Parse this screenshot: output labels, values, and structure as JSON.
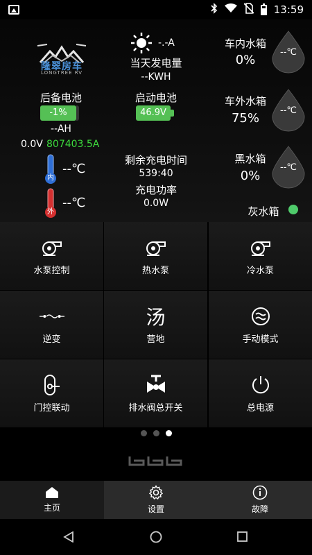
{
  "status_bar": {
    "time": "13:59"
  },
  "logo": {
    "text": "隆翠房车",
    "sub": "LONGTREE RV"
  },
  "solar": {
    "current": "-.-A",
    "label": "当天发电量",
    "kwh": "--KWH"
  },
  "backup_battery": {
    "label": "后备电池",
    "percent": "-1%",
    "ah": "--AH",
    "voltage": "0.0V",
    "current": "807403.5A"
  },
  "start_battery": {
    "label": "启动电池",
    "voltage": "46.9V"
  },
  "temperature": {
    "inside_tag": "内",
    "inside_value": "--℃",
    "outside_tag": "外",
    "outside_value": "--℃"
  },
  "charging": {
    "time_label": "剩余充电时间",
    "time_value": "539:40",
    "power_label": "充电功率",
    "power_value": "0.0W"
  },
  "tanks": {
    "fresh_inside": {
      "label": "车内水箱",
      "percent": "0%",
      "temp": "--℃"
    },
    "fresh_outside": {
      "label": "车外水箱",
      "percent": "75%",
      "temp": "--℃"
    },
    "black": {
      "label": "黑水箱",
      "percent": "0%",
      "temp": "--℃"
    },
    "grey": {
      "label": "灰水箱"
    }
  },
  "grid": [
    {
      "label": "水泵控制",
      "icon": "pump-icon"
    },
    {
      "label": "热水泵",
      "icon": "pump-icon"
    },
    {
      "label": "冷水泵",
      "icon": "pump-icon"
    },
    {
      "label": "逆变",
      "icon": "inverter-icon"
    },
    {
      "label": "营地",
      "icon": "camp-icon"
    },
    {
      "label": "手动模式",
      "icon": "wave-icon"
    },
    {
      "label": "门控联动",
      "icon": "door-icon"
    },
    {
      "label": "排水阀总开关",
      "icon": "valve-icon"
    },
    {
      "label": "总电源",
      "icon": "power-icon"
    }
  ],
  "grid_glyphs": {
    "camp": "汤"
  },
  "pagination": {
    "count": 3,
    "active": 3
  },
  "bottom_nav": [
    {
      "label": "主页",
      "icon": "home-icon"
    },
    {
      "label": "设置",
      "icon": "gear-icon"
    },
    {
      "label": "故障",
      "icon": "info-icon"
    }
  ],
  "colors": {
    "green": "#55c055",
    "current_green": "#3ddc3d",
    "temp_blue": "#2f6fd6",
    "temp_red": "#d43030",
    "dot_green": "#4fcb6b"
  }
}
